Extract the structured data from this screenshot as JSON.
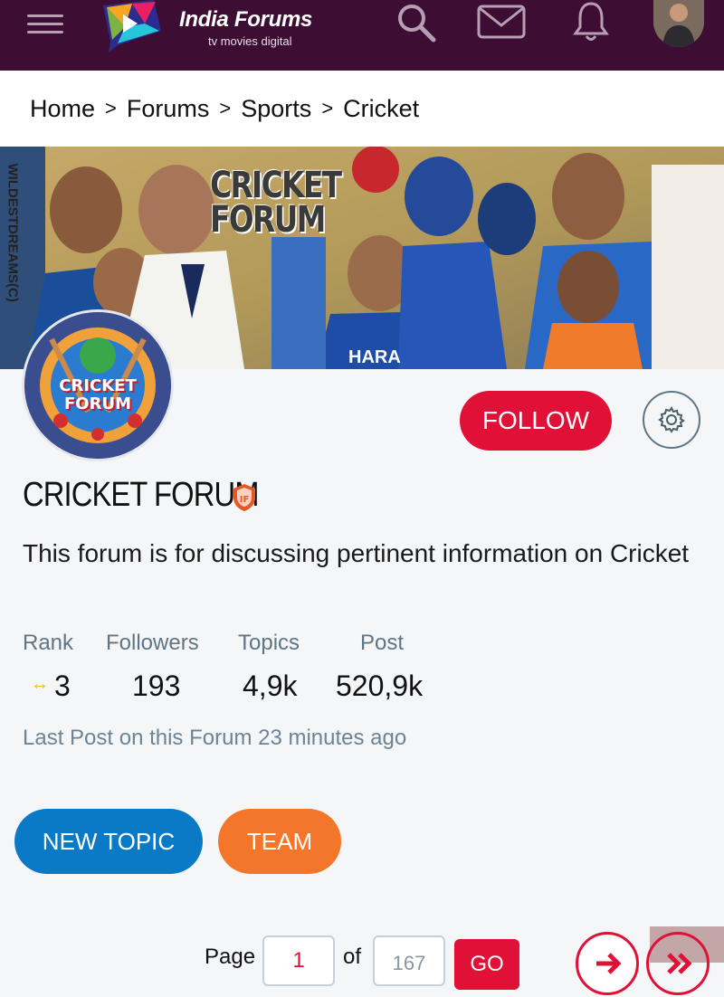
{
  "header": {
    "brand_title": "India Forums",
    "brand_tagline": "tv  movies  digital"
  },
  "breadcrumb": [
    "Home",
    "Forums",
    "Sports",
    "Cricket"
  ],
  "banner": {
    "title": "CRICKET FORUM",
    "side_text": "WILDESTDREAMS(C)",
    "sponsor_text": "HARA"
  },
  "forum": {
    "avatar_text": "CRICKET FORUM",
    "title": "CRICKET FORUM",
    "description": "This forum is for discussing pertinent information on Cricket",
    "follow_label": "FOLLOW",
    "stats": {
      "rank_label": "Rank",
      "rank_value": "3",
      "followers_label": "Followers",
      "followers_value": "193",
      "topics_label": "Topics",
      "topics_value": "4,9k",
      "post_label": "Post",
      "post_value": "520,9k"
    },
    "last_post": "Last Post on this Forum 23 minutes ago"
  },
  "actions": {
    "new_topic": "NEW TOPIC",
    "team": "TEAM"
  },
  "pagination": {
    "page_label": "Page",
    "current_page": "1",
    "of_label": "of",
    "total_pages": "167",
    "go_label": "GO"
  },
  "colors": {
    "nav_bg": "#3d0d33",
    "accent_red": "#e11037",
    "blue": "#0a7ac7",
    "orange": "#f4762a"
  }
}
